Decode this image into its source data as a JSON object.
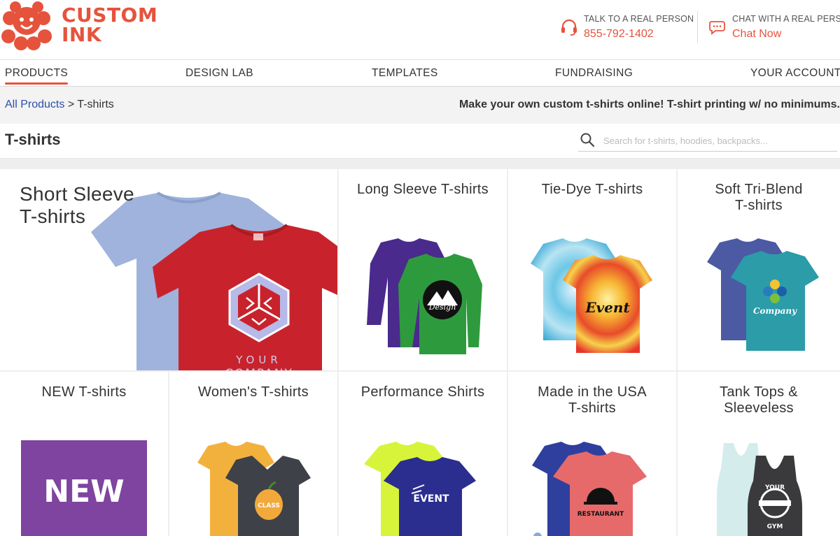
{
  "brand": {
    "line1": "CUSTOM",
    "line2": "INK",
    "color": "#e6533c"
  },
  "contact": {
    "phone": {
      "label": "TALK TO A REAL PERSON",
      "value": "855-792-1402",
      "icon": "headset-icon"
    },
    "chat": {
      "label": "CHAT WITH A REAL PERSON",
      "value": "Chat Now",
      "icon": "chat-bubble-icon"
    }
  },
  "nav": {
    "items": [
      {
        "label": "PRODUCTS",
        "active": true
      },
      {
        "label": "DESIGN LAB"
      },
      {
        "label": "TEMPLATES"
      },
      {
        "label": "FUNDRAISING"
      },
      {
        "label": "YOUR ACCOUNT"
      }
    ]
  },
  "breadcrumb": {
    "root": "All Products",
    "sep": ">",
    "current": "T-shirts"
  },
  "tagline": "Make your own custom t-shirts online! T-shirt printing w/ no minimums.",
  "page_title": "T-shirts",
  "search": {
    "placeholder": "Search for t-shirts, hoodies, backpacks..."
  },
  "categories": [
    {
      "title": "Short Sleeve T-shirts",
      "line1": "Short Sleeve",
      "line2": "T-shirts",
      "print": "YOUR COMPANY"
    },
    {
      "title": "Long Sleeve T-shirts",
      "print": "Your Design Here"
    },
    {
      "title": "Tie-Dye T-shirts",
      "print": "Your Event Here"
    },
    {
      "title": "Soft Tri-Blend T-shirts",
      "line1": "Soft Tri-Blend",
      "line2": "T-shirts",
      "print": "Company"
    },
    {
      "title": "NEW T-shirts",
      "badge": "NEW"
    },
    {
      "title": "Women's T-shirts",
      "print": "Your Class Here"
    },
    {
      "title": "Performance Shirts",
      "print": "Your Event"
    },
    {
      "title": "Made in the USA T-shirts",
      "line1": "Made in the USA",
      "line2": "T-shirts",
      "print": "Your Restaurant Here"
    },
    {
      "title": "Tank Tops & Sleeveless",
      "line1": "Tank Tops &",
      "line2": "Sleeveless",
      "print": "Your Gym"
    }
  ]
}
